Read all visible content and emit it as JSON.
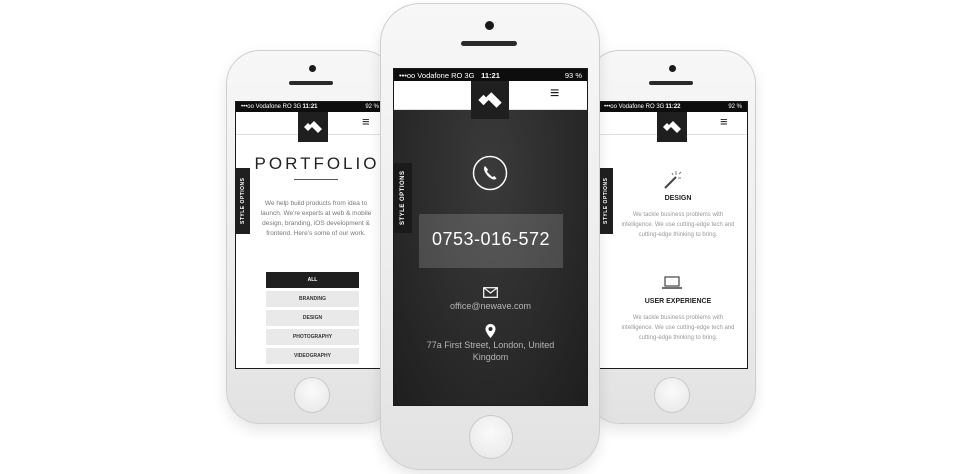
{
  "left_phone": {
    "status": {
      "carrier": "•••oo Vodafone RO  3G",
      "time": "11:21",
      "battery": "92 %"
    },
    "style_tab": "STYLE OPTIONS",
    "menu_glyph": "≡",
    "title": "PORTFOLIO",
    "description": "We help build products from idea to launch. We're experts at web & mobile design, branding, iOS development & frontend. Here's some of our work.",
    "filters": [
      "ALL",
      "BRANDING",
      "DESIGN",
      "PHOTOGRAPHY",
      "VIDEOGRAPHY"
    ],
    "active_filter": "ALL"
  },
  "center_phone": {
    "status": {
      "carrier": "•••oo Vodafone RO  3G",
      "time": "11:21",
      "battery": "93 %"
    },
    "style_tab": "STYLE OPTIONS",
    "menu_glyph": "≡",
    "phone_number": "0753-016-572",
    "email": "office@newave.com",
    "address": "77a First Street, London, United Kingdom"
  },
  "right_phone": {
    "status": {
      "carrier": "•••oo Vodafone RO  3G",
      "time": "11:22",
      "battery": "92 %"
    },
    "style_tab": "STYLE OPTIONS",
    "menu_glyph": "≡",
    "services": [
      {
        "title": "DESIGN",
        "icon": "magic-wand-icon",
        "text": "We tackle business problems with intelligence. We use cutting-edge tech and cutting-edge thinking to bring."
      },
      {
        "title": "USER EXPERIENCE",
        "icon": "laptop-icon",
        "text": "We tackle business problems with intelligence. We use cutting-edge tech and cutting-edge thinking to bring."
      }
    ]
  },
  "colors": {
    "dark": "#1f1f1f",
    "screen_dark": "#2b2b2b",
    "light_gray": "#e9e9e9"
  }
}
